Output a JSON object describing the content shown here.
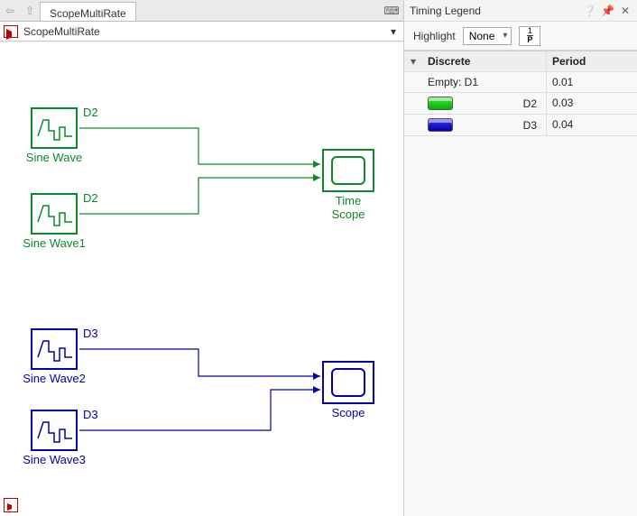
{
  "tab": {
    "title": "ScopeMultiRate"
  },
  "breadcrumb": {
    "text": "ScopeMultiRate"
  },
  "blocks": {
    "sine0": {
      "label": "Sine Wave",
      "rate": "D2"
    },
    "sine1": {
      "label": "Sine Wave1",
      "rate": "D2"
    },
    "sine2": {
      "label": "Sine Wave2",
      "rate": "D3"
    },
    "sine3": {
      "label": "Sine Wave3",
      "rate": "D3"
    },
    "timescope": {
      "label_line1": "Time",
      "label_line2": "Scope"
    },
    "scope": {
      "label": "Scope"
    }
  },
  "legend": {
    "panel_title": "Timing Legend",
    "highlight_label": "Highlight",
    "highlight_value": "None",
    "col_discrete": "Discrete",
    "col_period": "Period",
    "rows": [
      {
        "name": "Empty: D1",
        "period": "0.01",
        "swatch": ""
      },
      {
        "name": "D2",
        "period": "0.03",
        "swatch": "green"
      },
      {
        "name": "D3",
        "period": "0.04",
        "swatch": "blue"
      }
    ]
  }
}
